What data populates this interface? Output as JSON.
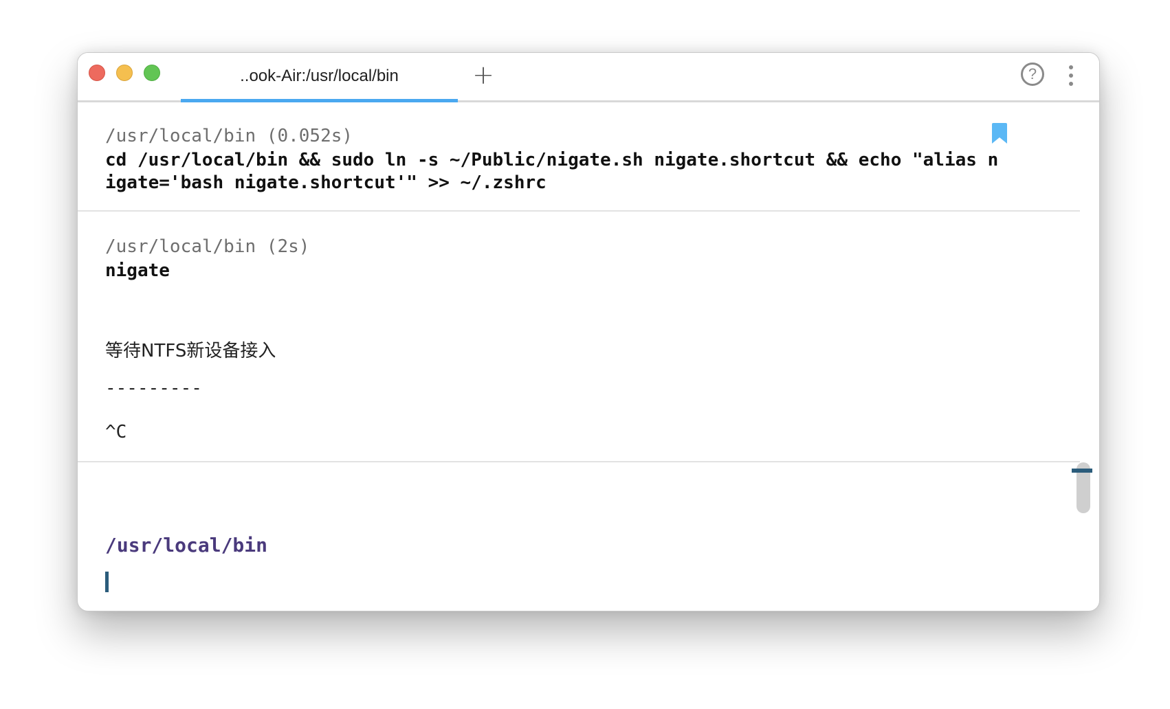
{
  "window": {
    "tab_title": "..ook-Air:/usr/local/bin",
    "new_tab_symbol": "+",
    "help_symbol": "?"
  },
  "blocks": [
    {
      "info": "/usr/local/bin (0.052s)",
      "command": "cd /usr/local/bin && sudo ln -s ~/Public/nigate.sh nigate.shortcut && echo \"alias nigate='bash nigate.shortcut'\" >> ~/.zshrc",
      "bookmarked": true
    },
    {
      "info": "/usr/local/bin (2s)",
      "command": "nigate",
      "output": [
        "等待NTFS新设备接入",
        "---------",
        "^C"
      ]
    }
  ],
  "prompt": {
    "path": "/usr/local/bin"
  },
  "colors": {
    "tab_accent": "#4aa8f0",
    "bookmark": "#5bb8f5",
    "prompt_path": "#4a3a7c",
    "cursor": "#2b5c7b"
  },
  "icons": [
    "close-icon",
    "minimize-icon",
    "maximize-icon",
    "plus-icon",
    "help-icon",
    "more-vertical-icon",
    "bookmark-icon"
  ]
}
